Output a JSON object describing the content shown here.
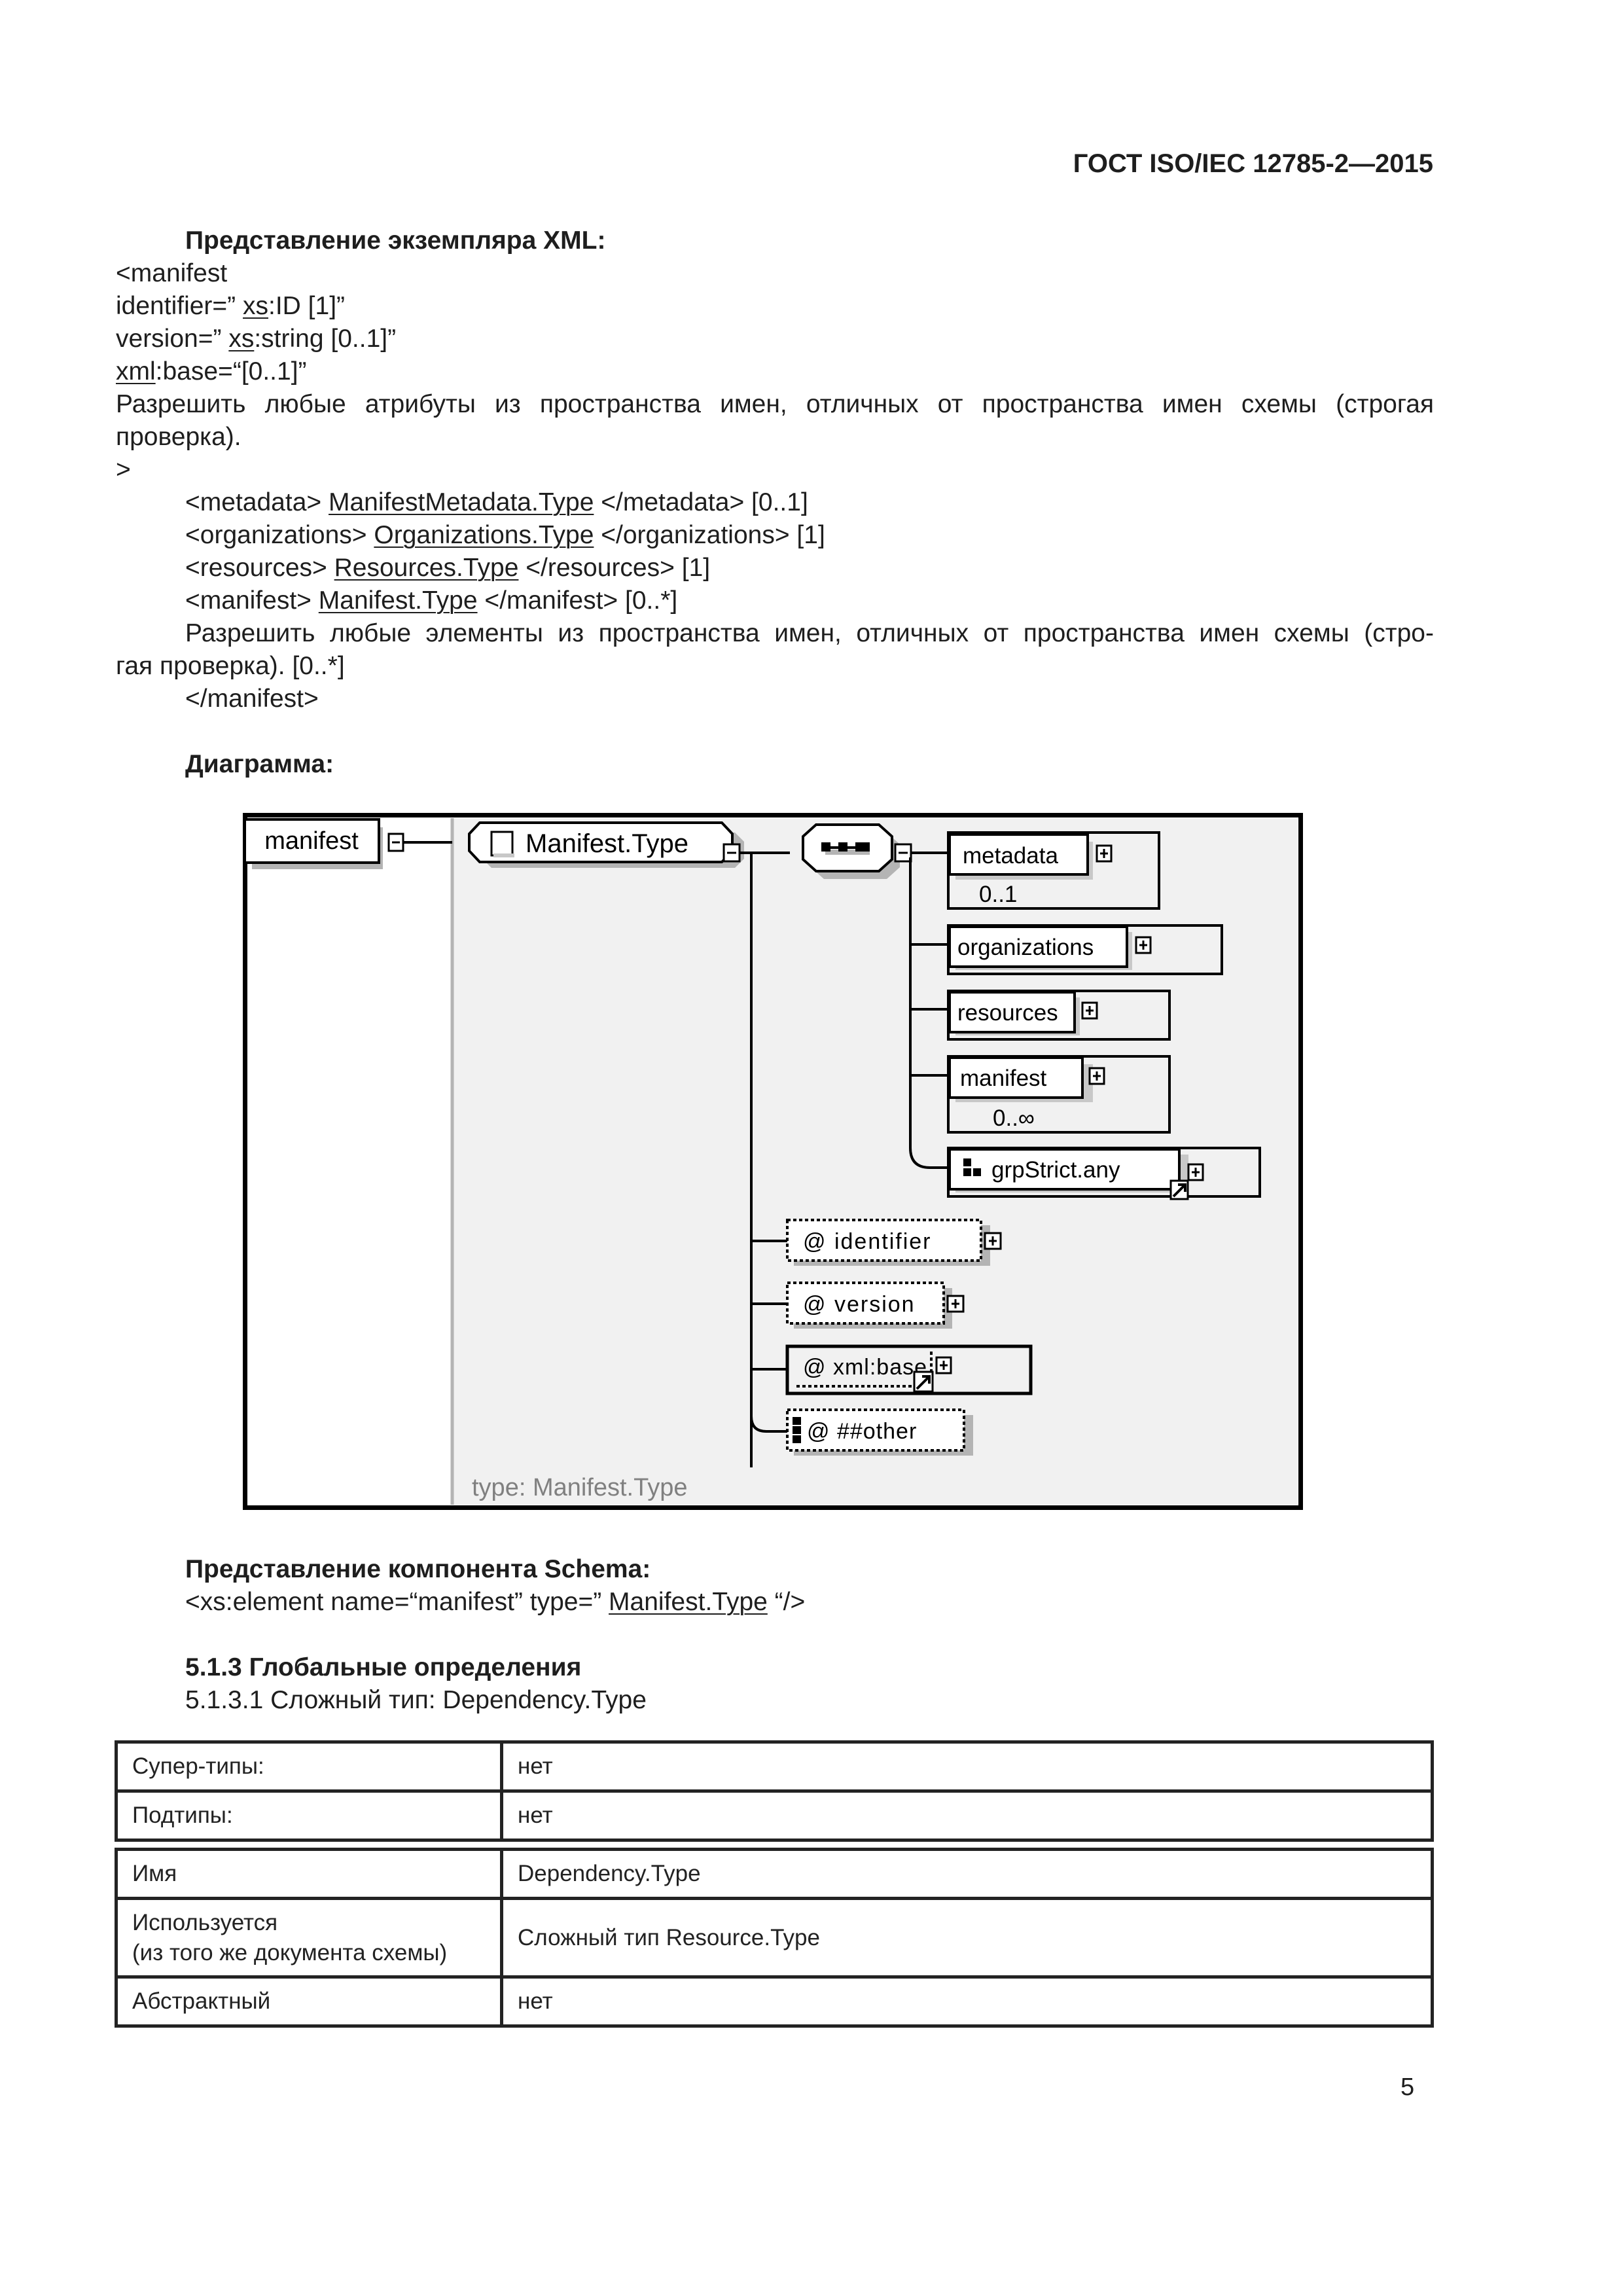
{
  "header": {
    "standard": "ГОСТ ISO/IEC 12785-2—2015"
  },
  "xml_instance": {
    "heading": "Представление экземпляра XML:",
    "open_tag": "<manifest",
    "attr_identifier": {
      "prefix": "identifier=” ",
      "link": "xs",
      "suffix": ":ID [1]”"
    },
    "attr_version": {
      "prefix": "version=” ",
      "link": "xs",
      "suffix": ":string [0..1]”"
    },
    "attr_base": {
      "link": "xml",
      "suffix": ":base=“[0..1]”"
    },
    "any_attr_line1": "Разрешить любые атрибуты из пространства имен, отличных от пространства имен схемы (строгая",
    "any_attr_line2": "проверка).",
    "close_bracket": ">",
    "children": [
      {
        "open": "<metadata> ",
        "type": "ManifestMetadata.Type",
        "close": " </metadata> [0..1]"
      },
      {
        "open": "<organizations> ",
        "type": "Organizations.Type",
        "close": " </organizations> [1]"
      },
      {
        "open": "<resources> ",
        "type": "Resources.Type",
        "close": " </resources> [1]"
      },
      {
        "open": "<manifest> ",
        "type": "Manifest.Type",
        "close": " </manifest> [0..*]"
      }
    ],
    "any_elem_line1": "Разрешить любые элементы из пространства имен, отличных от пространства имен схемы (стро-",
    "any_elem_line2": "гая проверка). [0..*]",
    "end_tag": "</manifest>"
  },
  "diagram": {
    "heading": "Диаграмма:",
    "root_element": "manifest",
    "complex_type": "Manifest.Type",
    "type_caption": "type: Manifest.Type",
    "elements": [
      {
        "name": "metadata",
        "occurs": "0..1"
      },
      {
        "name": "organizations",
        "occurs": ""
      },
      {
        "name": "resources",
        "occurs": ""
      },
      {
        "name": "manifest",
        "occurs": "0..∞"
      }
    ],
    "group": {
      "name": "grpStrict.any"
    },
    "attributes": [
      {
        "name": "@ identifier"
      },
      {
        "name": "@ version"
      },
      {
        "name": "@ xml:base"
      },
      {
        "name": "@ ##other"
      }
    ],
    "colors": {
      "panel": "#f1f1f1",
      "shadow": "#b4b4b4",
      "caption": "#808080",
      "divider": "#b4b4b4"
    }
  },
  "schema_component": {
    "heading": "Представление компонента Schema:",
    "prefix": "<xs:element name=“manifest” type=” ",
    "link": "Manifest.Type",
    "suffix": " “/>"
  },
  "section": {
    "heading": "5.1.3  Глобальные определения",
    "subheading": "5.1.3.1  Сложный тип: Dependency.Type"
  },
  "table1": {
    "rows": [
      {
        "key": "Супер-типы:",
        "value": "нет"
      },
      {
        "key": "Подтипы:",
        "value": "нет"
      }
    ]
  },
  "table2": {
    "rows": [
      {
        "key": "Имя",
        "value": "Dependency.Type"
      },
      {
        "key": "Используется",
        "key2": "(из того же документа схемы)",
        "value": "Сложный тип Resource.Type"
      },
      {
        "key": "Абстрактный",
        "value": "нет"
      }
    ]
  },
  "page_number": "5"
}
